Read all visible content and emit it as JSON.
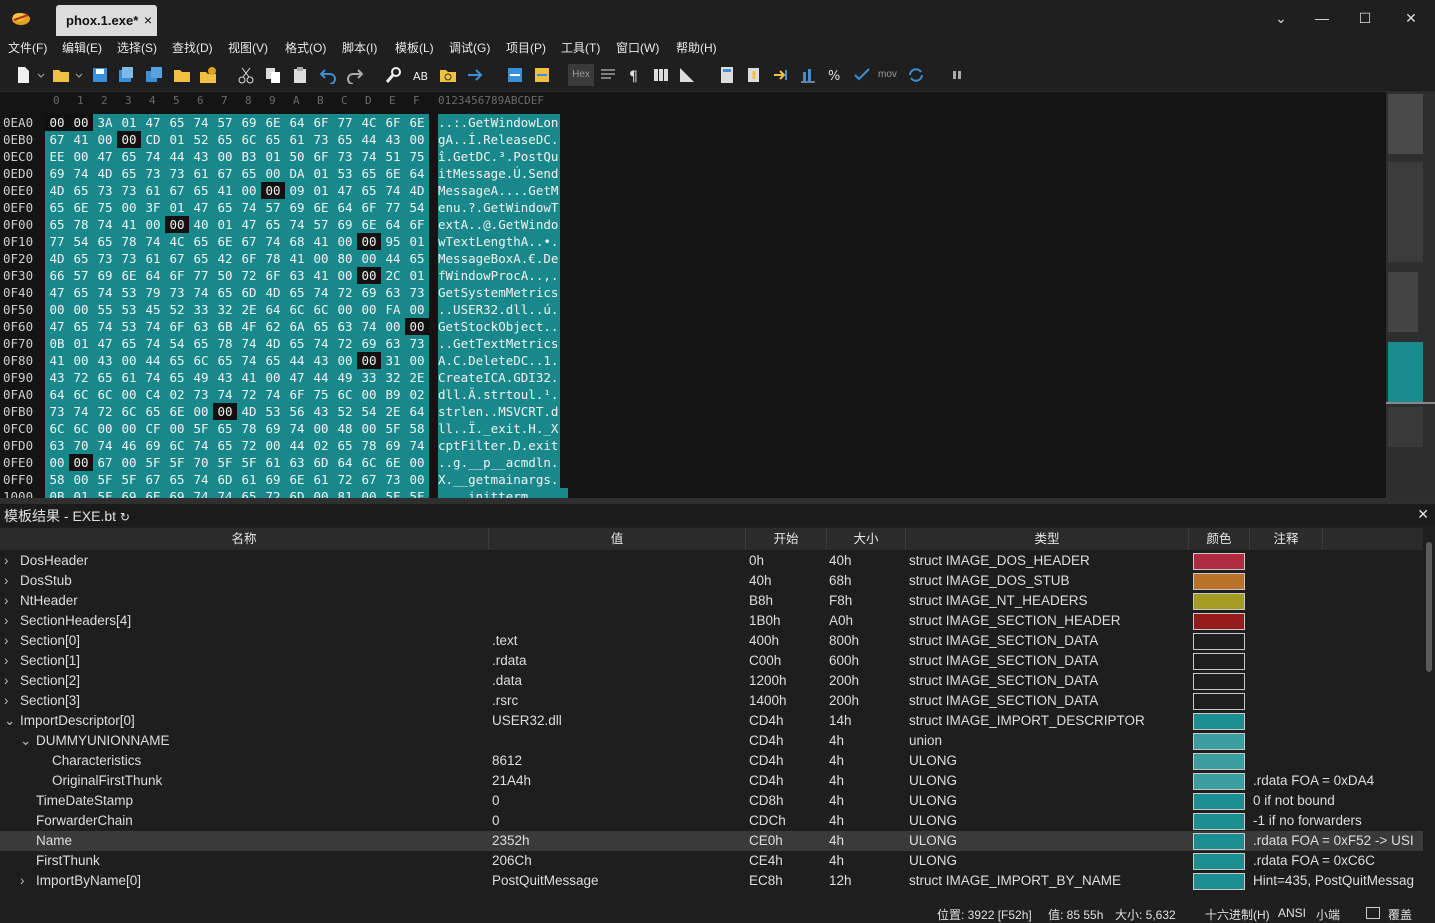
{
  "window": {
    "tab_title": "phox.1.exe*",
    "tab_close": "×",
    "dropdown": "⌄",
    "minimize": "—",
    "maximize": "☐",
    "close": "✕"
  },
  "menu": [
    "文件(F)",
    "编辑(E)",
    "选择(S)",
    "查找(D)",
    "视图(V)",
    "格式(O)",
    "脚本(I)",
    "模板(L)",
    "调试(G)",
    "项目(P)",
    "工具(T)",
    "窗口(W)",
    "帮助(H)"
  ],
  "toolbar": {
    "hex_label": "Hex",
    "mov_label": "mov"
  },
  "hex": {
    "col_headers": [
      "0",
      "1",
      "2",
      "3",
      "4",
      "5",
      "6",
      "7",
      "8",
      "9",
      "A",
      "B",
      "C",
      "D",
      "E",
      "F"
    ],
    "ascii_header": "0123456789ABCDEF",
    "rows": [
      {
        "addr": "0EA0",
        "bytes": [
          "00",
          "00",
          "3A",
          "01",
          "47",
          "65",
          "74",
          "57",
          "69",
          "6E",
          "64",
          "6F",
          "77",
          "4C",
          "6F",
          "6E"
        ],
        "ascii": "..:.GetWindowLon"
      },
      {
        "addr": "0EB0",
        "bytes": [
          "67",
          "41",
          "00",
          "00",
          "CD",
          "01",
          "52",
          "65",
          "6C",
          "65",
          "61",
          "73",
          "65",
          "44",
          "43",
          "00"
        ],
        "ascii": "gA..Í.ReleaseDC."
      },
      {
        "addr": "0EC0",
        "bytes": [
          "EE",
          "00",
          "47",
          "65",
          "74",
          "44",
          "43",
          "00",
          "B3",
          "01",
          "50",
          "6F",
          "73",
          "74",
          "51",
          "75"
        ],
        "ascii": "î.GetDC.³.PostQu"
      },
      {
        "addr": "0ED0",
        "bytes": [
          "69",
          "74",
          "4D",
          "65",
          "73",
          "73",
          "61",
          "67",
          "65",
          "00",
          "DA",
          "01",
          "53",
          "65",
          "6E",
          "64"
        ],
        "ascii": "itMessage.Ú.Send"
      },
      {
        "addr": "0EE0",
        "bytes": [
          "4D",
          "65",
          "73",
          "73",
          "61",
          "67",
          "65",
          "41",
          "00",
          "00",
          "09",
          "01",
          "47",
          "65",
          "74",
          "4D"
        ],
        "ascii": "MessageA....GetM"
      },
      {
        "addr": "0EF0",
        "bytes": [
          "65",
          "6E",
          "75",
          "00",
          "3F",
          "01",
          "47",
          "65",
          "74",
          "57",
          "69",
          "6E",
          "64",
          "6F",
          "77",
          "54"
        ],
        "ascii": "enu.?.GetWindowT"
      },
      {
        "addr": "0F00",
        "bytes": [
          "65",
          "78",
          "74",
          "41",
          "00",
          "00",
          "40",
          "01",
          "47",
          "65",
          "74",
          "57",
          "69",
          "6E",
          "64",
          "6F"
        ],
        "ascii": "extA..@.GetWindo"
      },
      {
        "addr": "0F10",
        "bytes": [
          "77",
          "54",
          "65",
          "78",
          "74",
          "4C",
          "65",
          "6E",
          "67",
          "74",
          "68",
          "41",
          "00",
          "00",
          "95",
          "01"
        ],
        "ascii": "wTextLengthA..•."
      },
      {
        "addr": "0F20",
        "bytes": [
          "4D",
          "65",
          "73",
          "73",
          "61",
          "67",
          "65",
          "42",
          "6F",
          "78",
          "41",
          "00",
          "80",
          "00",
          "44",
          "65"
        ],
        "ascii": "MessageBoxA.€.De"
      },
      {
        "addr": "0F30",
        "bytes": [
          "66",
          "57",
          "69",
          "6E",
          "64",
          "6F",
          "77",
          "50",
          "72",
          "6F",
          "63",
          "41",
          "00",
          "00",
          "2C",
          "01"
        ],
        "ascii": "fWindowProcA..,."
      },
      {
        "addr": "0F40",
        "bytes": [
          "47",
          "65",
          "74",
          "53",
          "79",
          "73",
          "74",
          "65",
          "6D",
          "4D",
          "65",
          "74",
          "72",
          "69",
          "63",
          "73"
        ],
        "ascii": "GetSystemMetrics"
      },
      {
        "addr": "0F50",
        "bytes": [
          "00",
          "00",
          "55",
          "53",
          "45",
          "52",
          "33",
          "32",
          "2E",
          "64",
          "6C",
          "6C",
          "00",
          "00",
          "FA",
          "00"
        ],
        "ascii": "..USER32.dll..ú."
      },
      {
        "addr": "0F60",
        "bytes": [
          "47",
          "65",
          "74",
          "53",
          "74",
          "6F",
          "63",
          "6B",
          "4F",
          "62",
          "6A",
          "65",
          "63",
          "74",
          "00",
          "00"
        ],
        "ascii": "GetStockObject.."
      },
      {
        "addr": "0F70",
        "bytes": [
          "0B",
          "01",
          "47",
          "65",
          "74",
          "54",
          "65",
          "78",
          "74",
          "4D",
          "65",
          "74",
          "72",
          "69",
          "63",
          "73"
        ],
        "ascii": "..GetTextMetrics"
      },
      {
        "addr": "0F80",
        "bytes": [
          "41",
          "00",
          "43",
          "00",
          "44",
          "65",
          "6C",
          "65",
          "74",
          "65",
          "44",
          "43",
          "00",
          "00",
          "31",
          "00"
        ],
        "ascii": "A.C.DeleteDC..1."
      },
      {
        "addr": "0F90",
        "bytes": [
          "43",
          "72",
          "65",
          "61",
          "74",
          "65",
          "49",
          "43",
          "41",
          "00",
          "47",
          "44",
          "49",
          "33",
          "32",
          "2E"
        ],
        "ascii": "CreateICA.GDI32."
      },
      {
        "addr": "0FA0",
        "bytes": [
          "64",
          "6C",
          "6C",
          "00",
          "C4",
          "02",
          "73",
          "74",
          "72",
          "74",
          "6F",
          "75",
          "6C",
          "00",
          "B9",
          "02"
        ],
        "ascii": "dll.Ä.strtoul.¹."
      },
      {
        "addr": "0FB0",
        "bytes": [
          "73",
          "74",
          "72",
          "6C",
          "65",
          "6E",
          "00",
          "00",
          "4D",
          "53",
          "56",
          "43",
          "52",
          "54",
          "2E",
          "64"
        ],
        "ascii": "strlen..MSVCRT.d"
      },
      {
        "addr": "0FC0",
        "bytes": [
          "6C",
          "6C",
          "00",
          "00",
          "CF",
          "00",
          "5F",
          "65",
          "78",
          "69",
          "74",
          "00",
          "48",
          "00",
          "5F",
          "58"
        ],
        "ascii": "ll..Ï._exit.H._X"
      },
      {
        "addr": "0FD0",
        "bytes": [
          "63",
          "70",
          "74",
          "46",
          "69",
          "6C",
          "74",
          "65",
          "72",
          "00",
          "44",
          "02",
          "65",
          "78",
          "69",
          "74"
        ],
        "ascii": "cptFilter.D.exit"
      },
      {
        "addr": "0FE0",
        "bytes": [
          "00",
          "00",
          "67",
          "00",
          "5F",
          "5F",
          "70",
          "5F",
          "5F",
          "61",
          "63",
          "6D",
          "64",
          "6C",
          "6E",
          "00"
        ],
        "ascii": "..g.__p__acmdln."
      },
      {
        "addr": "0FF0",
        "bytes": [
          "58",
          "00",
          "5F",
          "5F",
          "67",
          "65",
          "74",
          "6D",
          "61",
          "69",
          "6E",
          "61",
          "72",
          "67",
          "73",
          "00"
        ],
        "ascii": "X.__getmainargs."
      },
      {
        "addr": "1000",
        "bytes": [
          "0B",
          "01",
          "5F",
          "69",
          "6E",
          "69",
          "74",
          "74",
          "65",
          "72",
          "6D",
          "00",
          "81",
          "00",
          "5F",
          "5F"
        ],
        "ascii": "..__initterm...__"
      }
    ]
  },
  "template_panel": {
    "title": "模板结果 - EXE.bt",
    "refresh_icon": "↻",
    "close_icon": "✕",
    "columns": [
      "名称",
      "值",
      "开始",
      "大小",
      "类型",
      "颜色",
      "注释"
    ],
    "rows": [
      {
        "indent": 0,
        "chev": "›",
        "name": "DosHeader",
        "value": "",
        "start": "0h",
        "size": "40h",
        "type": "struct IMAGE_DOS_HEADER",
        "color": "#b02a3f",
        "comment": ""
      },
      {
        "indent": 0,
        "chev": "›",
        "name": "DosStub",
        "value": "",
        "start": "40h",
        "size": "68h",
        "type": "struct IMAGE_DOS_STUB",
        "color": "#b8722a",
        "comment": ""
      },
      {
        "indent": 0,
        "chev": "›",
        "name": "NtHeader",
        "value": "",
        "start": "B8h",
        "size": "F8h",
        "type": "struct IMAGE_NT_HEADERS",
        "color": "#a49b22",
        "comment": ""
      },
      {
        "indent": 0,
        "chev": "›",
        "name": "SectionHeaders[4]",
        "value": "",
        "start": "1B0h",
        "size": "A0h",
        "type": "struct IMAGE_SECTION_HEADER",
        "color": "#961b1b",
        "comment": ""
      },
      {
        "indent": 0,
        "chev": "›",
        "name": "Section[0]",
        "value": ".text",
        "start": "400h",
        "size": "800h",
        "type": "struct IMAGE_SECTION_DATA",
        "color": "#1e1e1e",
        "comment": ""
      },
      {
        "indent": 0,
        "chev": "›",
        "name": "Section[1]",
        "value": ".rdata",
        "start": "C00h",
        "size": "600h",
        "type": "struct IMAGE_SECTION_DATA",
        "color": "#1e1e1e",
        "comment": ""
      },
      {
        "indent": 0,
        "chev": "›",
        "name": "Section[2]",
        "value": ".data",
        "start": "1200h",
        "size": "200h",
        "type": "struct IMAGE_SECTION_DATA",
        "color": "#1e1e1e",
        "comment": ""
      },
      {
        "indent": 0,
        "chev": "›",
        "name": "Section[3]",
        "value": ".rsrc",
        "start": "1400h",
        "size": "200h",
        "type": "struct IMAGE_SECTION_DATA",
        "color": "#1e1e1e",
        "comment": ""
      },
      {
        "indent": 0,
        "chev": "⌄",
        "name": "ImportDescriptor[0]",
        "value": "USER32.dll",
        "start": "CD4h",
        "size": "14h",
        "type": "struct IMAGE_IMPORT_DESCRIPTOR",
        "color": "#1b8e92",
        "comment": ""
      },
      {
        "indent": 1,
        "chev": "⌄",
        "name": "DUMMYUNIONNAME",
        "value": "",
        "start": "CD4h",
        "size": "4h",
        "type": "union",
        "color": "#3a9da0",
        "comment": ""
      },
      {
        "indent": 2,
        "chev": "",
        "name": "Characteristics",
        "value": "8612",
        "start": "CD4h",
        "size": "4h",
        "type": "ULONG",
        "color": "#3a9da0",
        "comment": ""
      },
      {
        "indent": 2,
        "chev": "",
        "name": "OriginalFirstThunk",
        "value": "21A4h",
        "start": "CD4h",
        "size": "4h",
        "type": "ULONG",
        "color": "#3a9da0",
        "comment": ".rdata FOA = 0xDA4"
      },
      {
        "indent": 1,
        "chev": "",
        "name": "TimeDateStamp",
        "value": "0",
        "start": "CD8h",
        "size": "4h",
        "type": "ULONG",
        "color": "#1b8e92",
        "comment": "0 if not bound"
      },
      {
        "indent": 1,
        "chev": "",
        "name": "ForwarderChain",
        "value": "0",
        "start": "CDCh",
        "size": "4h",
        "type": "ULONG",
        "color": "#1b8e92",
        "comment": "-1 if no forwarders"
      },
      {
        "indent": 1,
        "chev": "",
        "name": "Name",
        "value": "2352h",
        "start": "CE0h",
        "size": "4h",
        "type": "ULONG",
        "color": "#1b8e92",
        "comment": ".rdata FOA = 0xF52 -> USI",
        "selected": true
      },
      {
        "indent": 1,
        "chev": "",
        "name": "FirstThunk",
        "value": "206Ch",
        "start": "CE4h",
        "size": "4h",
        "type": "ULONG",
        "color": "#1b8e92",
        "comment": ".rdata FOA = 0xC6C"
      },
      {
        "indent": 1,
        "chev": "›",
        "name": "ImportByName[0]",
        "value": "PostQuitMessage",
        "start": "EC8h",
        "size": "12h",
        "type": "struct IMAGE_IMPORT_BY_NAME",
        "color": "#1b8e92",
        "comment": "Hint=435, PostQuitMessag"
      }
    ]
  },
  "status": {
    "position": "位置: 3922 [F52h]",
    "value": "值: 85 55h",
    "size": "大小: 5,632",
    "encoding_mode": "十六进制(H)",
    "charset": "ANSI",
    "endian": "小端",
    "mode": "覆盖"
  },
  "colors": {
    "hex_highlight": "#18888b",
    "hex_dark_cell": "#101010",
    "accent_selected": "#3a3a3a"
  }
}
